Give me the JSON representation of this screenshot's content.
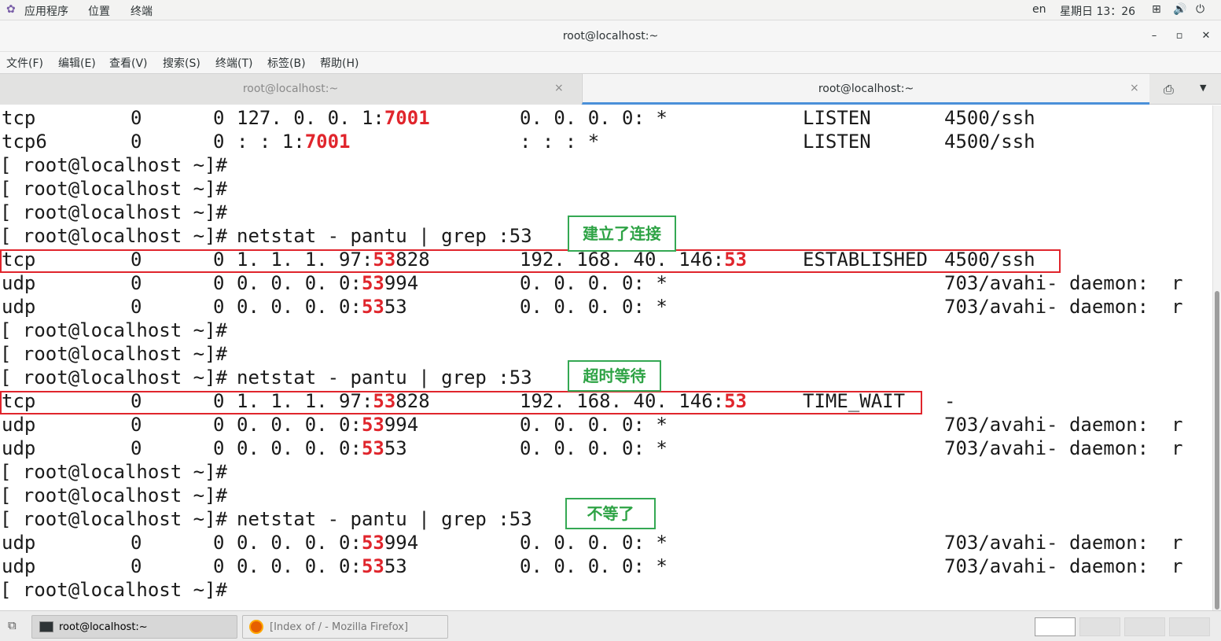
{
  "topbar": {
    "apps_menu": "应用程序",
    "places_menu": "位置",
    "terminal_menu": "终端",
    "lang": "en",
    "clock": "星期日 13：26"
  },
  "window": {
    "title": "root@localhost:~",
    "minimize": "–",
    "maximize": "▫",
    "close": "✕"
  },
  "menubar": [
    "文件(F)",
    "编辑(E)",
    "查看(V)",
    "搜索(S)",
    "终端(T)",
    "标签(B)",
    "帮助(H)"
  ],
  "tabs": [
    {
      "label": "root@localhost:~",
      "close": "×"
    },
    {
      "label": "root@localhost:~",
      "close": "×"
    }
  ],
  "terminal": {
    "prompt": "[ root@localhost ~]#",
    "command": "netstat - pantu | grep :53",
    "lines": [
      {
        "kind": "row",
        "proto": "tcp",
        "recv": "0",
        "send": "0",
        "local": "127. 0. 0. 1:",
        "local_red": "7001",
        "local_rest": "",
        "foreign": "0. 0. 0. 0: *",
        "foreign_red": "",
        "state": "LISTEN",
        "pid": "4500/ssh"
      },
      {
        "kind": "row",
        "proto": "tcp6",
        "recv": "0",
        "send": "0",
        "local": ": : 1:",
        "local_red": "7001",
        "local_rest": "",
        "foreign": ": : : *",
        "foreign_red": "",
        "state": "LISTEN",
        "pid": "4500/ssh"
      },
      {
        "kind": "prompt"
      },
      {
        "kind": "prompt"
      },
      {
        "kind": "prompt"
      },
      {
        "kind": "cmd"
      },
      {
        "kind": "row",
        "proto": "tcp",
        "recv": "0",
        "send": "0",
        "local": "1. 1. 1. 97:",
        "local_red": "53",
        "local_rest": "828",
        "foreign": "192. 168. 40. 146:",
        "foreign_red": "53",
        "state": "ESTABLISHED",
        "pid": "4500/ssh"
      },
      {
        "kind": "row",
        "proto": "udp",
        "recv": "0",
        "send": "0",
        "local": "0. 0. 0. 0:",
        "local_red": "53",
        "local_rest": "994",
        "foreign": "0. 0. 0. 0: *",
        "foreign_red": "",
        "state": "",
        "pid": "703/avahi- daemon:  r"
      },
      {
        "kind": "row",
        "proto": "udp",
        "recv": "0",
        "send": "0",
        "local": "0. 0. 0. 0:",
        "local_red": "53",
        "local_rest": "53",
        "foreign": "0. 0. 0. 0: *",
        "foreign_red": "",
        "state": "",
        "pid": "703/avahi- daemon:  r"
      },
      {
        "kind": "prompt"
      },
      {
        "kind": "prompt"
      },
      {
        "kind": "cmd"
      },
      {
        "kind": "row",
        "proto": "tcp",
        "recv": "0",
        "send": "0",
        "local": "1. 1. 1. 97:",
        "local_red": "53",
        "local_rest": "828",
        "foreign": "192. 168. 40. 146:",
        "foreign_red": "53",
        "state": "TIME_WAIT",
        "pid": "-"
      },
      {
        "kind": "row",
        "proto": "udp",
        "recv": "0",
        "send": "0",
        "local": "0. 0. 0. 0:",
        "local_red": "53",
        "local_rest": "994",
        "foreign": "0. 0. 0. 0: *",
        "foreign_red": "",
        "state": "",
        "pid": "703/avahi- daemon:  r"
      },
      {
        "kind": "row",
        "proto": "udp",
        "recv": "0",
        "send": "0",
        "local": "0. 0. 0. 0:",
        "local_red": "53",
        "local_rest": "53",
        "foreign": "0. 0. 0. 0: *",
        "foreign_red": "",
        "state": "",
        "pid": "703/avahi- daemon:  r"
      },
      {
        "kind": "prompt"
      },
      {
        "kind": "prompt"
      },
      {
        "kind": "cmd"
      },
      {
        "kind": "row",
        "proto": "udp",
        "recv": "0",
        "send": "0",
        "local": "0. 0. 0. 0:",
        "local_red": "53",
        "local_rest": "994",
        "foreign": "0. 0. 0. 0: *",
        "foreign_red": "",
        "state": "",
        "pid": "703/avahi- daemon:  r"
      },
      {
        "kind": "row",
        "proto": "udp",
        "recv": "0",
        "send": "0",
        "local": "0. 0. 0. 0:",
        "local_red": "53",
        "local_rest": "53",
        "foreign": "0. 0. 0. 0: *",
        "foreign_red": "",
        "state": "",
        "pid": "703/avahi- daemon:  r"
      },
      {
        "kind": "prompt"
      }
    ]
  },
  "annotations": {
    "established": "建立了连接",
    "time_wait": "超时等待",
    "gone": "不等了"
  },
  "taskbar": {
    "tasks": [
      "root@localhost:~",
      "[Index of / - Mozilla Firefox]"
    ]
  },
  "colors": {
    "highlight_red": "#e0252c",
    "annotation_green": "#2ea345"
  }
}
